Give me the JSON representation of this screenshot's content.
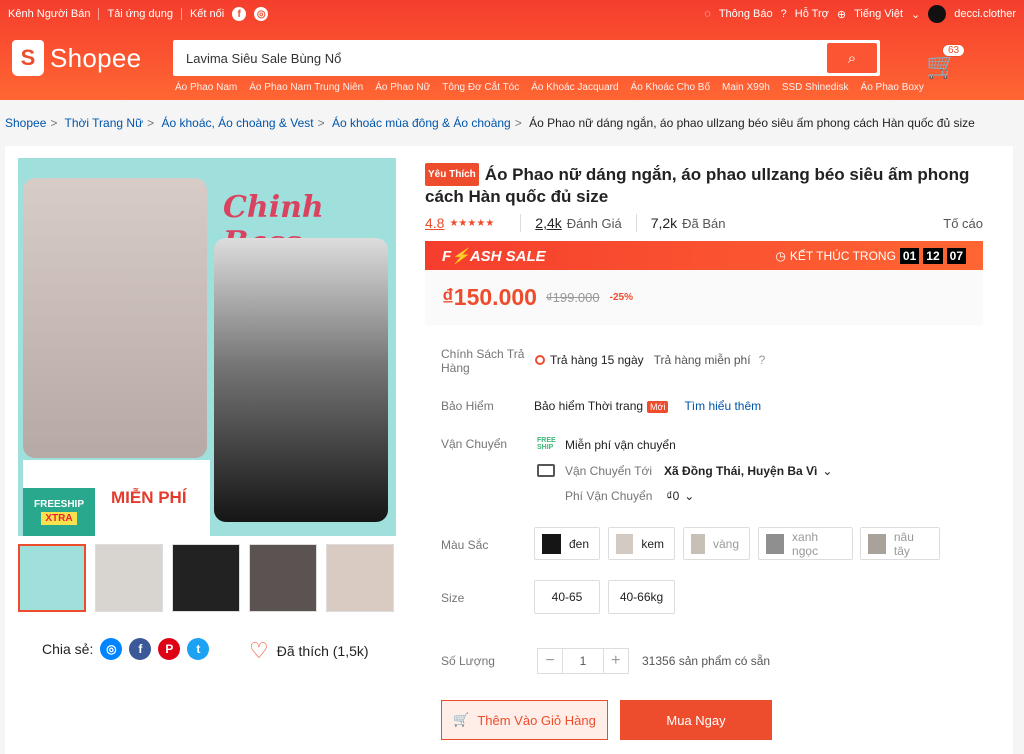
{
  "topbar": {
    "seller": "Kênh Người Bán",
    "app": "Tải ứng dụng",
    "connect": "Kết nối",
    "facebook": "f",
    "instagram": "◎",
    "notify": "Thông Báo",
    "help": "Hỗ Trợ",
    "language": "Tiếng Việt",
    "user": "decci.clother"
  },
  "logo": {
    "brand": "Shopee",
    "mark": "S"
  },
  "search": {
    "value": "Lavima Siêu Sale Bùng Nổ",
    "icon": "search-icon"
  },
  "cart": {
    "count": "63"
  },
  "suggestions": [
    "Áo Phao Nam",
    "Áo Phao Nam Trung Niên",
    "Áo Phao Nữ",
    "Tông Đơ Cắt Tóc",
    "Áo Khoác Jacquard",
    "Áo Khoác Cho Bố",
    "Main X99h",
    "SSD Shinedisk",
    "Áo Phao Boxy"
  ],
  "breadcrumb": [
    "Shopee",
    "Thời Trang Nữ",
    "Áo khoác, Áo choàng & Vest",
    "Áo khoác mùa đông & Áo choàng",
    "Áo Phao nữ dáng ngắn, áo phao ullzang béo siêu ấm phong cách Hàn quốc đủ size"
  ],
  "gallery": {
    "script": "Chinh Bass",
    "freeship": "FREESHIP",
    "xtra": "XTRA",
    "promo": "MIỄN PHÍ"
  },
  "share": {
    "label": "Chia sẻ:",
    "icons": [
      "messenger-icon",
      "facebook-icon",
      "pinterest-icon",
      "twitter-icon"
    ]
  },
  "favorite": {
    "label": "Đã thích (1,5k)"
  },
  "product": {
    "badge": "Yêu Thích",
    "title": "Áo Phao nữ dáng ngắn, áo phao ullzang béo siêu ấm phong cách Hàn quốc đủ size",
    "rating": "4.8",
    "stars": "★★★★★",
    "reviews": "2,4k",
    "reviews_label": "Đánh Giá",
    "sold": "7,2k",
    "sold_label": "Đã Bán",
    "report": "Tố cáo"
  },
  "flash": {
    "label": "F⚡ASH SALE",
    "end": "KẾT THÚC TRONG",
    "hours": "01",
    "minutes": "12",
    "seconds": "07"
  },
  "price": {
    "current": "₫150.000",
    "old": "₫199.000",
    "discount": "-25%"
  },
  "policy": {
    "label": "Chính Sách Trả Hàng",
    "value": "Trả hàng 15 ngày",
    "extra": "Trả hàng miễn phí",
    "help": "?"
  },
  "insurance": {
    "label": "Bảo Hiểm",
    "value": "Bảo hiểm Thời trang",
    "badge": "Mới",
    "link": "Tìm hiểu thêm"
  },
  "shipping": {
    "label": "Vận Chuyển",
    "free": "Miễn phí vận chuyển",
    "freeship_icon": "FREE SHIP",
    "to_label": "Vận Chuyển Tới",
    "to": "Xã Đồng Thái, Huyện Ba Vì",
    "fee_label": "Phí Vận Chuyển",
    "fee": "₫0"
  },
  "colors": {
    "label": "Màu Sắc",
    "options": [
      {
        "label": "đen",
        "available": true
      },
      {
        "label": "kem",
        "available": true
      },
      {
        "label": "vàng",
        "available": false
      },
      {
        "label": "xanh ngọc",
        "available": false
      },
      {
        "label": "nâu tây",
        "available": false
      }
    ]
  },
  "size": {
    "label": "Size",
    "options": [
      "40-65",
      "40-66kg"
    ]
  },
  "quantity": {
    "label": "Số Lượng",
    "value": "1",
    "minus": "−",
    "plus": "+",
    "stock": "31356 sản phẩm có sẵn"
  },
  "actions": {
    "add_cart": "Thêm Vào Giỏ Hàng",
    "buy": "Mua Ngay"
  }
}
